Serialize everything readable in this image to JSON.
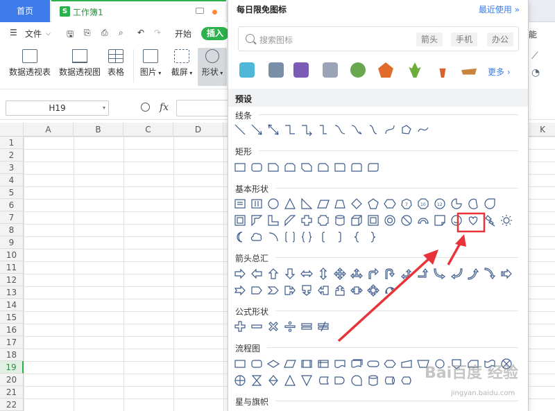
{
  "titlebar": {
    "home_tab": "首页",
    "book_tab": "工作簿1"
  },
  "menu": {
    "file": "文件",
    "start": "开始",
    "insert": "插入",
    "right_fragment": "能"
  },
  "ribbon": {
    "pivot_table": "数据透视表",
    "pivot_chart": "数据透视图",
    "table": "表格",
    "picture": "图片",
    "screenshot": "截屏",
    "shape": "形状"
  },
  "formula": {
    "cell_ref": "H19",
    "fx": "fx"
  },
  "sheet": {
    "columns": [
      "A",
      "B",
      "C",
      "D",
      "K"
    ],
    "rows": [
      "1",
      "2",
      "3",
      "4",
      "5",
      "6",
      "7",
      "8",
      "9",
      "10",
      "11",
      "12",
      "13",
      "14",
      "15",
      "16",
      "17",
      "18",
      "19",
      "20",
      "21",
      "22"
    ],
    "selected_row": "19"
  },
  "panel": {
    "title": "每日限免图标",
    "recent": "最近使用",
    "search_placeholder": "搜索图标",
    "chips": [
      "箭头",
      "手机",
      "办公"
    ],
    "more": "更多",
    "preset": "预设",
    "sections": {
      "lines": "线条",
      "rect": "矩形",
      "basic": "基本形状",
      "arrows": "箭头总汇",
      "formula": "公式形状",
      "flow": "流程图",
      "stars": "星与旗帜"
    }
  },
  "watermark": {
    "main": "Bai百度 经验",
    "sub": "jingyan.baidu.com"
  },
  "colors": {
    "accent_green": "#2bb24c",
    "tab_blue": "#3d7be8",
    "annotation_red": "#e8333a",
    "shape_stroke": "#3c5b8a"
  }
}
